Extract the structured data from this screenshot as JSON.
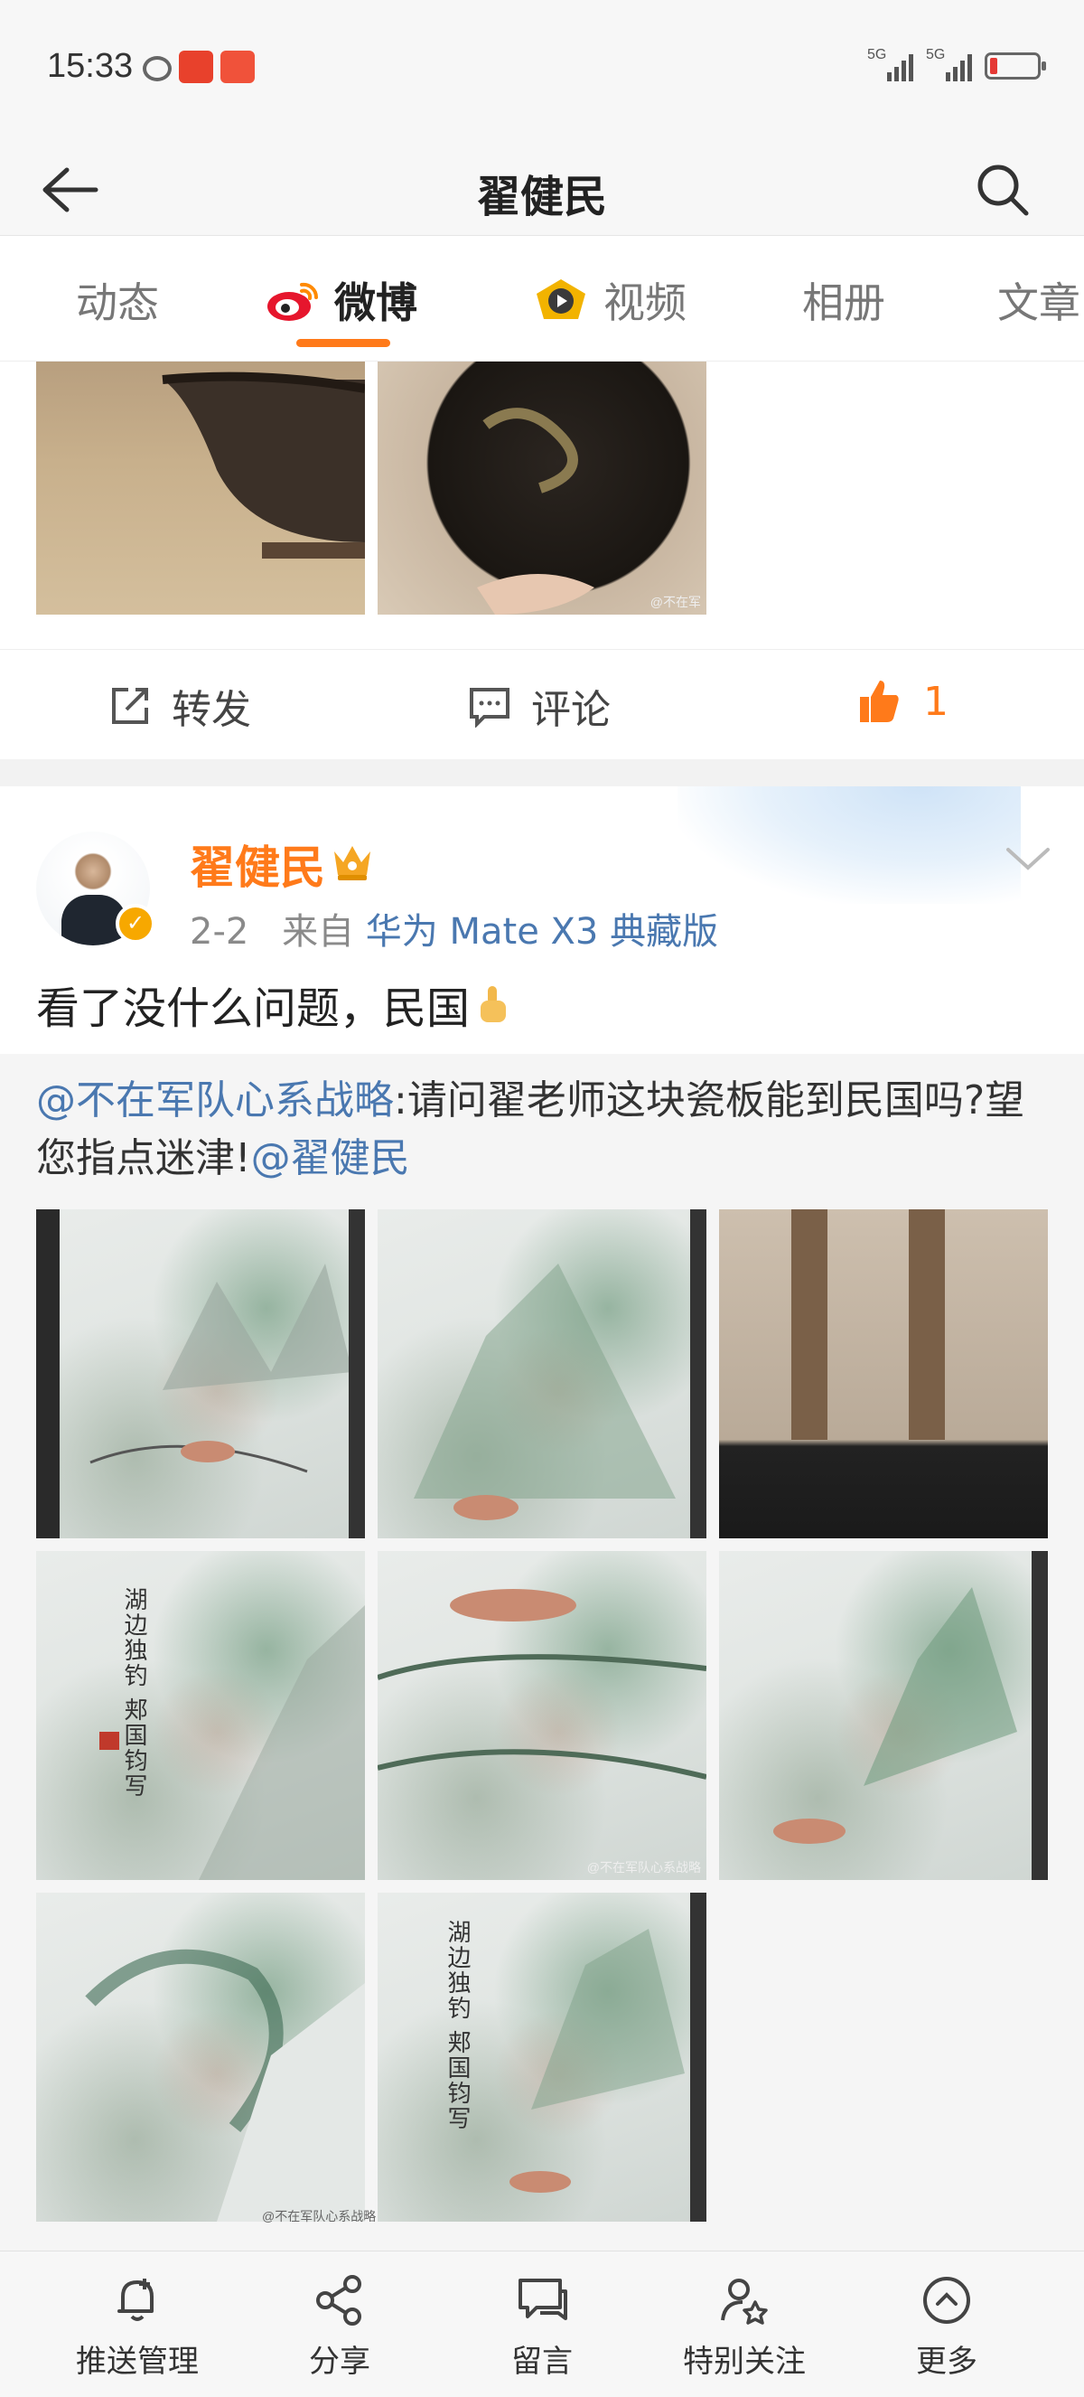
{
  "status_bar": {
    "time": "15:33",
    "network_labels": [
      "5G",
      "5G"
    ]
  },
  "nav": {
    "title": "翟健民",
    "back_icon": "back-arrow-icon",
    "search_icon": "search-icon"
  },
  "tabs": [
    {
      "label": "动态",
      "active": false
    },
    {
      "label": "微博",
      "active": true
    },
    {
      "label": "视频",
      "active": false
    },
    {
      "label": "相册",
      "active": false
    },
    {
      "label": "文章",
      "active": false
    }
  ],
  "post1": {
    "watermark": "@不在军",
    "actions": {
      "repost": "转发",
      "comment": "评论",
      "like_count": "1"
    }
  },
  "post2": {
    "author": "翟健民",
    "date": "2-2",
    "source_prefix": "来自",
    "source": "华为 Mate X3 典藏版",
    "text": "看了没什么问题，民国",
    "repost": {
      "mention": "@不在军队心系战略",
      "text": ":请问翟老师这块瓷板能到民国吗?望您指点迷津!",
      "mention2": "@翟健民"
    },
    "images_count": 8,
    "calligraphy": "湖边独钓 郏国钧写",
    "watermark1": "@不在军队心系战略",
    "watermark2": "@不在军队心系战略"
  },
  "bottom_bar": [
    {
      "label": "推送管理",
      "icon": "bell-add-icon"
    },
    {
      "label": "分享",
      "icon": "share-icon"
    },
    {
      "label": "留言",
      "icon": "message-icon"
    },
    {
      "label": "特别关注",
      "icon": "user-star-icon"
    },
    {
      "label": "更多",
      "icon": "chevron-up-circle-icon"
    }
  ],
  "colors": {
    "accent": "#ff7a1a",
    "link": "#4a78b0",
    "verified": "#f7a800"
  }
}
